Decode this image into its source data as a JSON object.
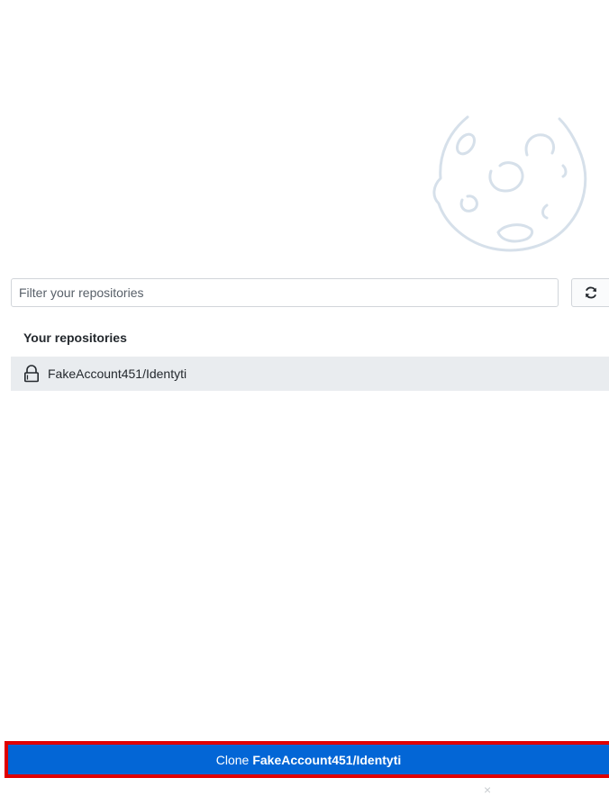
{
  "filter": {
    "placeholder": "Filter your repositories",
    "value": ""
  },
  "refresh": {
    "icon": "sync-icon"
  },
  "repositories": {
    "section_title": "Your repositories",
    "items": [
      {
        "name": "FakeAccount451/Identyti",
        "icon": "lock-icon",
        "selected": true
      }
    ]
  },
  "clone": {
    "prefix": "Clone",
    "repo": "FakeAccount451/Identyti"
  },
  "close": {
    "glyph": "×"
  },
  "colors": {
    "accent": "#0366d6",
    "highlight_border": "#e00000",
    "selected_row": "#e9ecef",
    "moon_stroke": "#d6e0ea"
  }
}
